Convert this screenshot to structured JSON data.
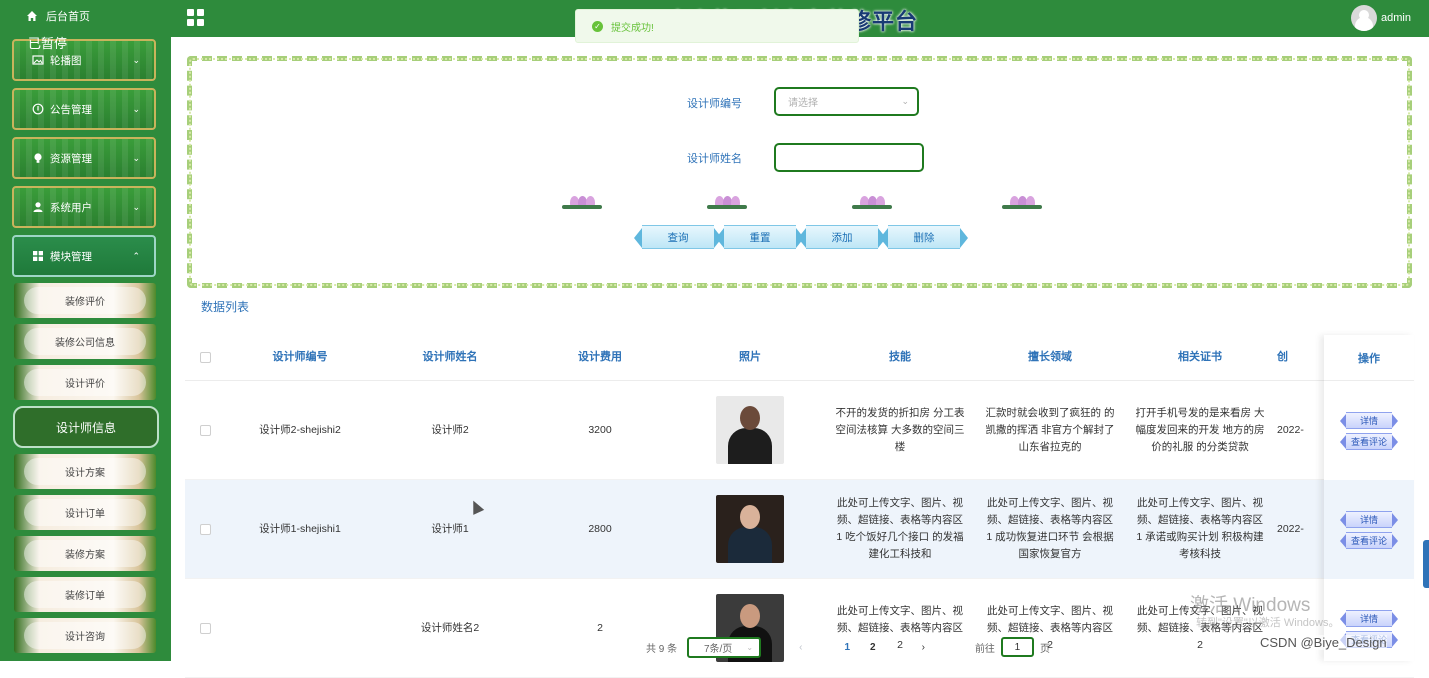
{
  "sidebar": {
    "home_label": "后台首页",
    "paused_label": "已暂停",
    "menus": [
      {
        "label": "轮播图",
        "icon": "image-icon"
      },
      {
        "label": "公告管理",
        "icon": "info-icon"
      },
      {
        "label": "资源管理",
        "icon": "bulb-icon"
      },
      {
        "label": "系统用户",
        "icon": "user-icon"
      },
      {
        "label": "模块管理",
        "icon": "grid-icon"
      }
    ],
    "submenus": [
      "装修评价",
      "装修公司信息",
      "设计评价",
      "设计师信息",
      "设计方案",
      "设计订单",
      "装修方案",
      "装修订单",
      "设计咨询"
    ],
    "active_submenu": "设计师信息"
  },
  "header": {
    "title": "欢迎使用创意家装修平台",
    "admin_name": "admin"
  },
  "toast": {
    "message": "提交成功!"
  },
  "search": {
    "designer_id_label": "设计师编号",
    "designer_id_placeholder": "请选择",
    "designer_name_label": "设计师姓名",
    "designer_name_value": "",
    "buttons": {
      "query": "查询",
      "reset": "重置",
      "add": "添加",
      "delete": "删除"
    }
  },
  "table": {
    "title": "数据列表",
    "columns": [
      "设计师编号",
      "设计师姓名",
      "设计费用",
      "照片",
      "技能",
      "擅长领域",
      "相关证书",
      "创",
      "操作"
    ],
    "rows": [
      {
        "id": "设计师2-shejishi2",
        "name": "设计师2",
        "fee": "3200",
        "skill": "不开的发货的折扣房 分工表 空间法核算 大多数的空间三楼",
        "area": "汇款时就会收到了疯狂的 的 凯撒的挥洒 非官方个解封了 山东省拉克的",
        "cert": "打开手机号发的是来看房 大幅度发回来的开发 地方的房价的礼服 的分类贷款",
        "date": "2022-"
      },
      {
        "id": "设计师1-shejishi1",
        "name": "设计师1",
        "fee": "2800",
        "skill": "此处可上传文字、图片、视频、超链接、表格等内容区1 吃个饭好几个接口 的发福建化工科技和",
        "area": "此处可上传文字、图片、视频、超链接、表格等内容区1 成功恢复进口环节 会根据国家恢复官方",
        "cert": "此处可上传文字、图片、视频、超链接、表格等内容区1 承诺或购买计划 积极构建考核科技",
        "date": "2022-"
      },
      {
        "id": "",
        "name": "设计师姓名2",
        "fee": "2",
        "skill": "此处可上传文字、图片、视频、超链接、表格等内容区2",
        "area": "此处可上传文字、图片、视频、超链接、表格等内容区2",
        "cert": "此处可上传文字、图片、视频、超链接、表格等内容区2",
        "date": ""
      }
    ],
    "ops": {
      "detail": "详情",
      "comments": "查看评论"
    }
  },
  "pagination": {
    "total": "共 9 条",
    "page_size": "7条/页",
    "pages": [
      "1",
      "2"
    ],
    "goto_label": "前往",
    "goto_value": "1",
    "page_word": "页"
  },
  "watermark": {
    "line1": "激活 Windows",
    "line2": "转到\"设置\"以激活 Windows。"
  },
  "credit": "CSDN @Biye_Design",
  "colors": {
    "sidebar_bg": "#2e8b3c",
    "accent_blue": "#2f73b8",
    "input_border": "#1f7a1f",
    "toast_green": "#67c23a"
  }
}
